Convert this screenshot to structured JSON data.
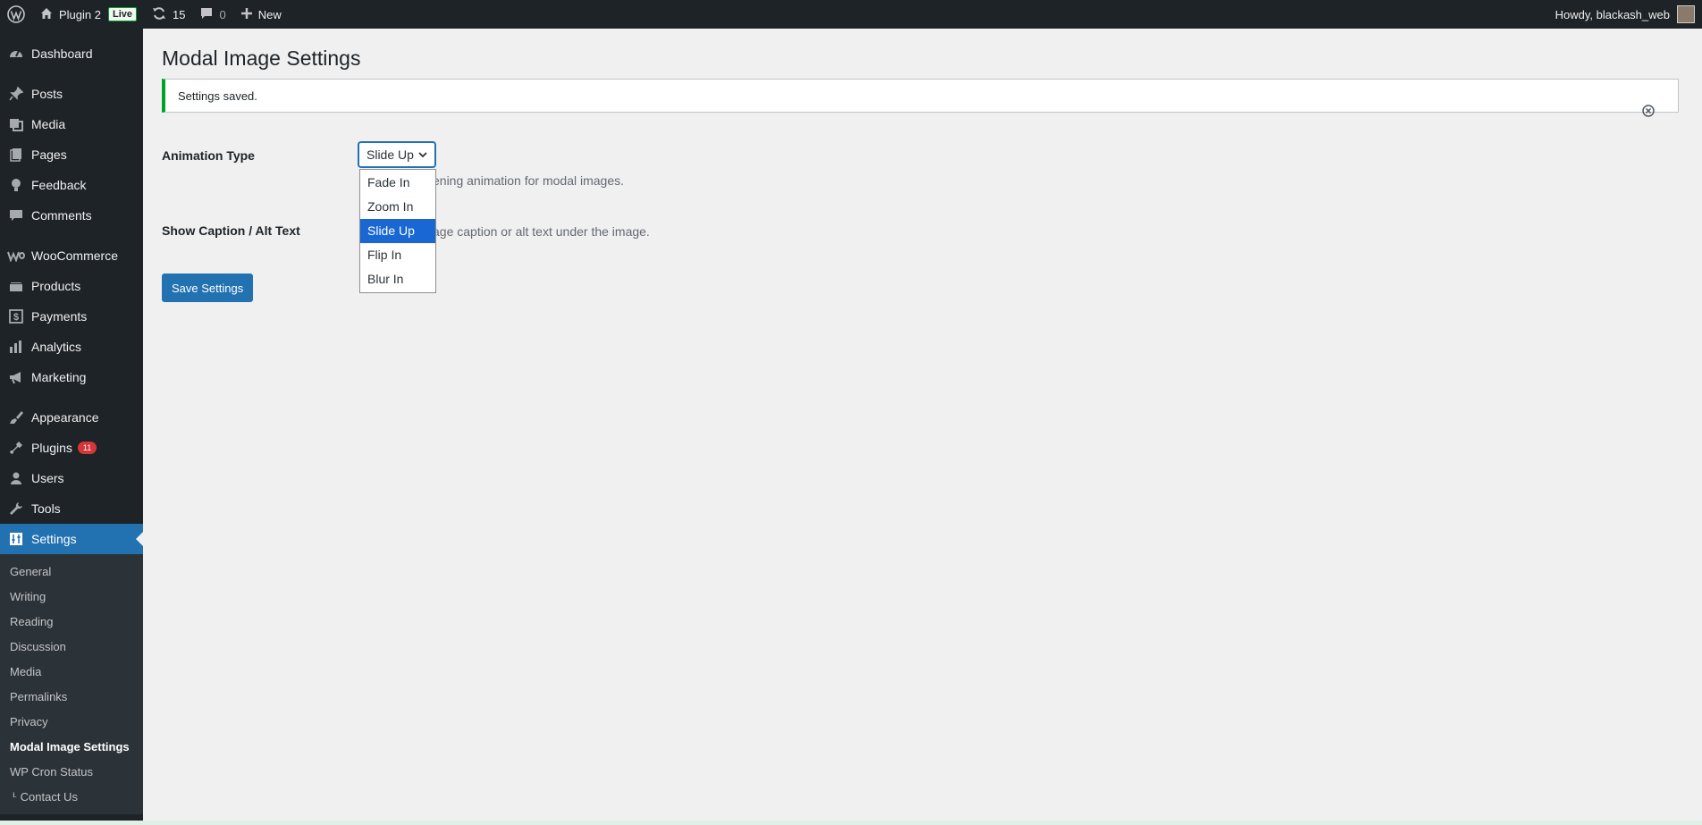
{
  "adminbar": {
    "site_name": "Plugin 2",
    "live_label": "Live",
    "updates_count": "15",
    "comments_count": "0",
    "new_label": "New",
    "howdy": "Howdy, blackash_web"
  },
  "sidebar": {
    "items": [
      {
        "label": "Dashboard",
        "icon": "dashboard-icon"
      },
      {
        "label": "Posts",
        "icon": "pin-icon"
      },
      {
        "label": "Media",
        "icon": "media-icon"
      },
      {
        "label": "Pages",
        "icon": "pages-icon"
      },
      {
        "label": "Feedback",
        "icon": "feedback-icon"
      },
      {
        "label": "Comments",
        "icon": "comments-icon"
      },
      {
        "label": "WooCommerce",
        "icon": "woocommerce-icon"
      },
      {
        "label": "Products",
        "icon": "products-icon"
      },
      {
        "label": "Payments",
        "icon": "payments-icon"
      },
      {
        "label": "Analytics",
        "icon": "analytics-icon"
      },
      {
        "label": "Marketing",
        "icon": "marketing-icon"
      },
      {
        "label": "Appearance",
        "icon": "appearance-icon"
      },
      {
        "label": "Plugins",
        "icon": "plugins-icon",
        "badge": "11"
      },
      {
        "label": "Users",
        "icon": "users-icon"
      },
      {
        "label": "Tools",
        "icon": "tools-icon"
      },
      {
        "label": "Settings",
        "icon": "settings-icon"
      }
    ],
    "submenu": [
      "General",
      "Writing",
      "Reading",
      "Discussion",
      "Media",
      "Permalinks",
      "Privacy",
      "Modal Image Settings",
      "WP Cron Status",
      "Contact Us"
    ]
  },
  "main": {
    "title": "Modal Image Settings",
    "notice": "Settings saved.",
    "animation_label": "Animation Type",
    "animation_value": "Slide Up",
    "animation_desc": "ening animation for modal images.",
    "caption_label": "Show Caption / Alt Text",
    "caption_desc": "age caption or alt text under the image.",
    "dropdown_options": [
      "Fade In",
      "Zoom In",
      "Slide Up",
      "Flip In",
      "Blur In"
    ],
    "save_label": "Save Settings"
  },
  "colors": {
    "accent": "#2271b1",
    "adminbar_bg": "#1d2327",
    "notice_success": "#00a32a",
    "dropdown_selected": "#1967d2"
  }
}
